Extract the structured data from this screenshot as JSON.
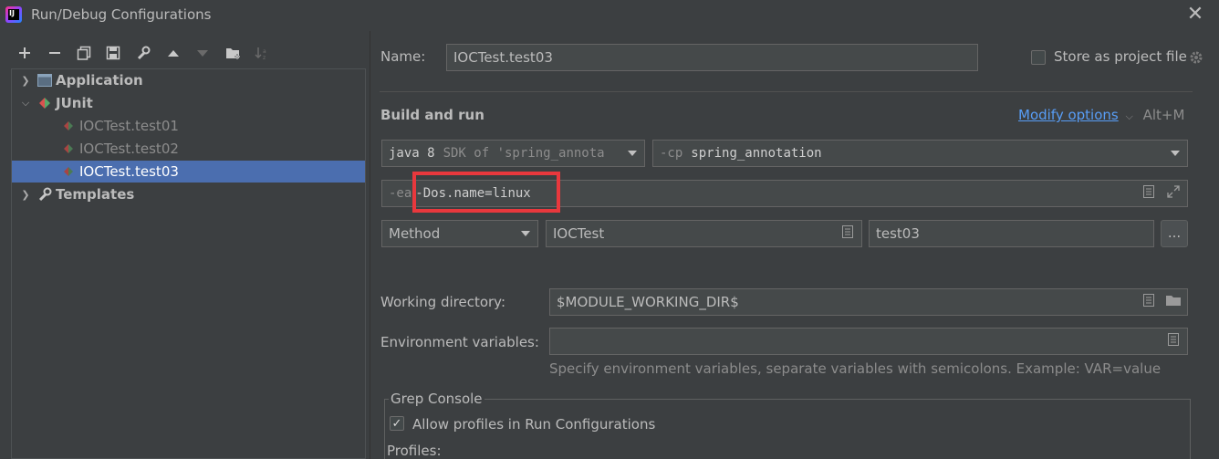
{
  "window": {
    "title": "Run/Debug Configurations"
  },
  "toolbar": {
    "icons": [
      "plus-icon",
      "minus-icon",
      "copy-icon",
      "save-icon",
      "wrench-icon",
      "arrow-up-icon",
      "arrow-down-icon",
      "folder-plus-icon",
      "sort-icon"
    ]
  },
  "tree": {
    "application": "Application",
    "junit": "JUnit",
    "items": [
      "IOCTest.test01",
      "IOCTest.test02",
      "IOCTest.test03"
    ],
    "templates": "Templates"
  },
  "form": {
    "name_label": "Name:",
    "name_value": "IOCTest.test03",
    "store_label": "Store as project file",
    "build_run_title": "Build and run",
    "modify_options": "Modify options",
    "modify_shortcut": "Alt+M",
    "jdk_value": "java 8",
    "jdk_suffix": "SDK of 'spring_annota",
    "cp_prefix": "-cp",
    "cp_value": "spring_annotation",
    "vm_prefix": "-ea",
    "vm_value": "-Dos.name=linux",
    "test_kind": "Method",
    "class_value": "IOCTest",
    "method_value": "test03",
    "more_btn": "...",
    "workdir_label": "Working directory:",
    "workdir_value": "$MODULE_WORKING_DIR$",
    "env_label": "Environment variables:",
    "env_value": "",
    "env_hint": "Specify environment variables, separate variables with semicolons. Example: VAR=value",
    "grep_title": "Grep Console",
    "allow_profiles": "Allow profiles in Run Configurations",
    "profiles_label": "Profiles:"
  },
  "colors": {
    "background": "#3c3f41",
    "selection": "#4b6eaf",
    "link": "#589df6",
    "highlight": "#e8383d"
  }
}
